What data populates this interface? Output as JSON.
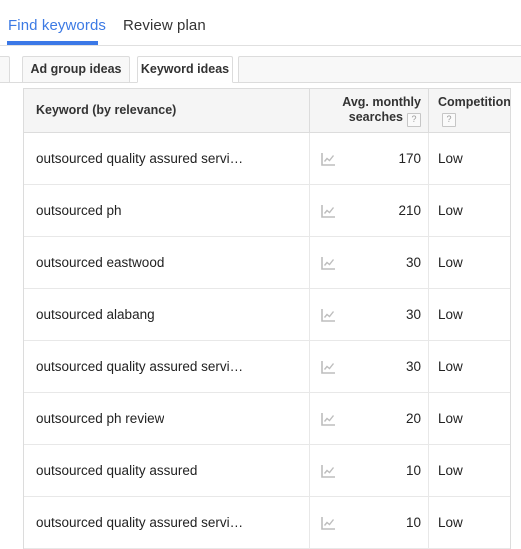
{
  "topnav": {
    "links": [
      {
        "label": "Find keywords",
        "active": true
      },
      {
        "label": "Review plan",
        "active": false
      }
    ]
  },
  "tabs": [
    {
      "label": "Ad group ideas",
      "active": false
    },
    {
      "label": "Keyword ideas",
      "active": true
    }
  ],
  "table": {
    "columns": [
      {
        "label": "Keyword (by relevance)",
        "help": false
      },
      {
        "label": "Avg. monthly searches",
        "help": true,
        "help_glyph": "?"
      },
      {
        "label": "Competition",
        "help": true,
        "help_glyph": "?"
      }
    ],
    "rows": [
      {
        "keyword": "outsourced quality assured servi…",
        "searches": "170",
        "competition": "Low",
        "trend_icon": "line-chart-icon"
      },
      {
        "keyword": "outsourced ph",
        "searches": "210",
        "competition": "Low",
        "trend_icon": "line-chart-icon"
      },
      {
        "keyword": "outsourced eastwood",
        "searches": "30",
        "competition": "Low",
        "trend_icon": "line-chart-icon"
      },
      {
        "keyword": "outsourced alabang",
        "searches": "30",
        "competition": "Low",
        "trend_icon": "line-chart-icon"
      },
      {
        "keyword": "outsourced quality assured servi…",
        "searches": "30",
        "competition": "Low",
        "trend_icon": "line-chart-icon"
      },
      {
        "keyword": "outsourced ph review",
        "searches": "20",
        "competition": "Low",
        "trend_icon": "line-chart-icon"
      },
      {
        "keyword": "outsourced quality assured",
        "searches": "10",
        "competition": "Low",
        "trend_icon": "line-chart-icon"
      },
      {
        "keyword": "outsourced quality assured servi…",
        "searches": "10",
        "competition": "Low",
        "trend_icon": "line-chart-icon"
      }
    ]
  },
  "colors": {
    "accent_blue": "#3b78e7",
    "link_blue": "#3c7ae4",
    "header_bg": "#f5f5f5",
    "border": "#dcdcdc",
    "row_border": "#e8e8e8",
    "text": "#222222",
    "icon_gray": "#bdbdbd"
  }
}
